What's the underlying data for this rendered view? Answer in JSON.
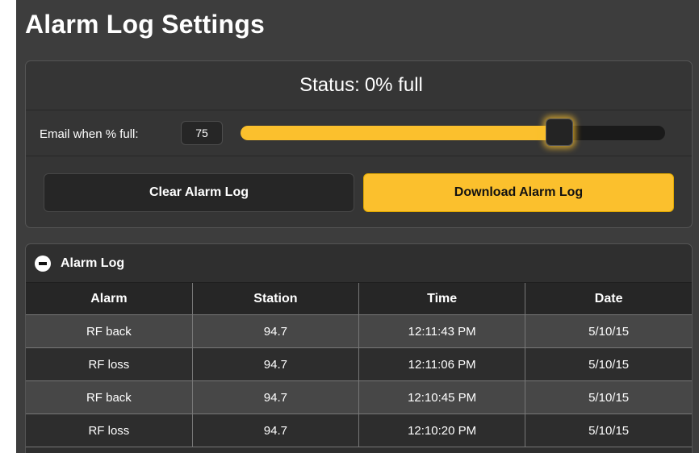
{
  "page": {
    "title": "Alarm Log Settings"
  },
  "settings": {
    "status_label": "Status:",
    "status_value": "0% full",
    "email_label": "Email when % full:",
    "email_threshold": "75",
    "slider_percent": 75,
    "accent_color": "#fbc02d"
  },
  "buttons": {
    "clear_label": "Clear Alarm Log",
    "download_label": "Download Alarm Log"
  },
  "log": {
    "title": "Alarm Log",
    "collapse_icon": "minus-circle-icon",
    "columns": [
      "Alarm",
      "Station",
      "Time",
      "Date"
    ],
    "rows": [
      [
        "RF back",
        "94.7",
        "12:11:43 PM",
        "5/10/15"
      ],
      [
        "RF loss",
        "94.7",
        "12:11:06 PM",
        "5/10/15"
      ],
      [
        "RF back",
        "94.7",
        "12:10:45 PM",
        "5/10/15"
      ],
      [
        "RF loss",
        "94.7",
        "12:10:20 PM",
        "5/10/15"
      ]
    ]
  }
}
